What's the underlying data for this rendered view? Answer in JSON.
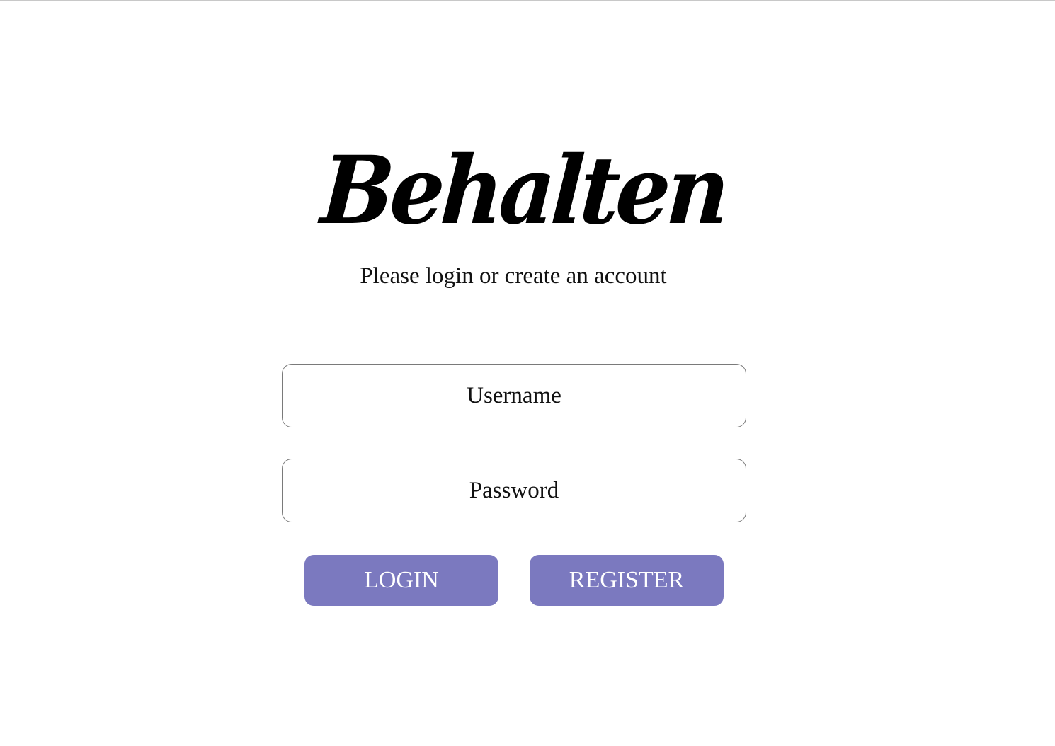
{
  "brand": {
    "logo_text": "Behalten"
  },
  "header": {
    "subtitle": "Please login or create an account"
  },
  "form": {
    "username_placeholder": "Username",
    "password_placeholder": "Password",
    "login_label": "LOGIN",
    "register_label": "REGISTER"
  },
  "colors": {
    "button_bg": "#7b79bf",
    "button_text": "#ffffff"
  }
}
